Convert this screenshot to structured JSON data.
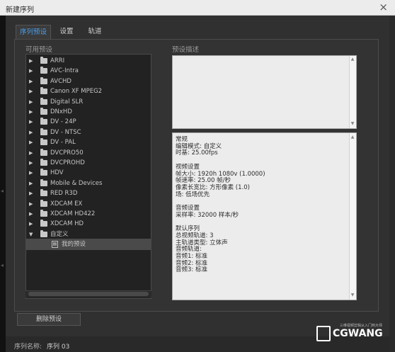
{
  "window": {
    "title": "新建序列",
    "close": "×"
  },
  "tabs": [
    {
      "label": "序列预设"
    },
    {
      "label": "设置"
    },
    {
      "label": "轨道"
    }
  ],
  "presets": {
    "heading": "可用预设",
    "items": [
      {
        "label": "ARRI"
      },
      {
        "label": "AVC-Intra"
      },
      {
        "label": "AVCHD"
      },
      {
        "label": "Canon XF MPEG2"
      },
      {
        "label": "Digital SLR"
      },
      {
        "label": "DNxHD"
      },
      {
        "label": "DV - 24P"
      },
      {
        "label": "DV - NTSC"
      },
      {
        "label": "DV - PAL"
      },
      {
        "label": "DVCPRO50"
      },
      {
        "label": "DVCPROHD"
      },
      {
        "label": "HDV"
      },
      {
        "label": "Mobile & Devices"
      },
      {
        "label": "RED R3D"
      },
      {
        "label": "XDCAM EX"
      },
      {
        "label": "XDCAM HD422"
      },
      {
        "label": "XDCAM HD"
      },
      {
        "label": "自定义"
      }
    ],
    "child": {
      "label": "我的预设"
    }
  },
  "description": {
    "heading": "预设描述",
    "lines": [
      "常规",
      " 编辑模式: 自定义",
      " 时基: 25.00fps",
      "",
      "视频设置",
      " 帧大小: 1920h 1080v (1.0000)",
      " 帧速率: 25.00 帧/秒",
      " 像素长宽比: 方形像素 (1.0)",
      " 场: 低场优先",
      "",
      "音频设置",
      " 采样率: 32000 样本/秒",
      "",
      "默认序列",
      " 总视频轨道: 3",
      " 主轨道类型: 立体声",
      " 音频轨道:",
      " 音频1: 标准",
      " 音频2: 标准",
      " 音频3: 标准"
    ]
  },
  "buttons": {
    "delete_preset": "删除预设"
  },
  "sequence_name": {
    "label": "序列名称:",
    "value": "序列 03"
  },
  "watermark": {
    "brand": "CGWANG",
    "tagline": "三维视频剪辑从入门到大师"
  }
}
